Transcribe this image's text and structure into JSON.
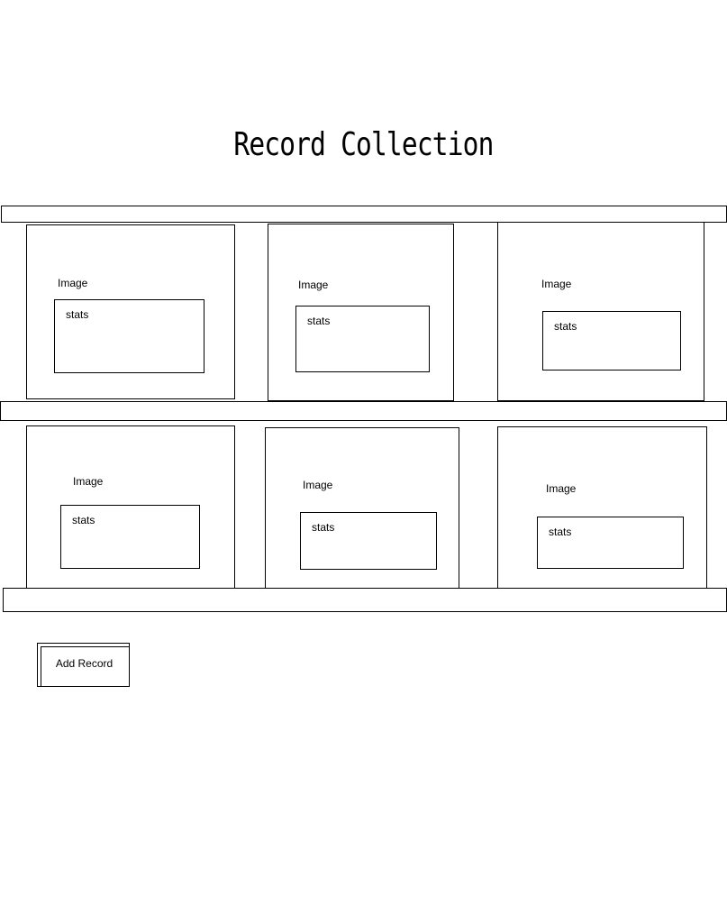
{
  "page": {
    "title": "Record Collection"
  },
  "records": [
    {
      "image_label": "Image",
      "stats_label": "stats"
    },
    {
      "image_label": "Image",
      "stats_label": "stats"
    },
    {
      "image_label": "Image",
      "stats_label": "stats"
    },
    {
      "image_label": "Image",
      "stats_label": "stats"
    },
    {
      "image_label": "Image",
      "stats_label": "stats"
    },
    {
      "image_label": "Image",
      "stats_label": "stats"
    }
  ],
  "actions": {
    "add_record_label": "Add Record"
  }
}
